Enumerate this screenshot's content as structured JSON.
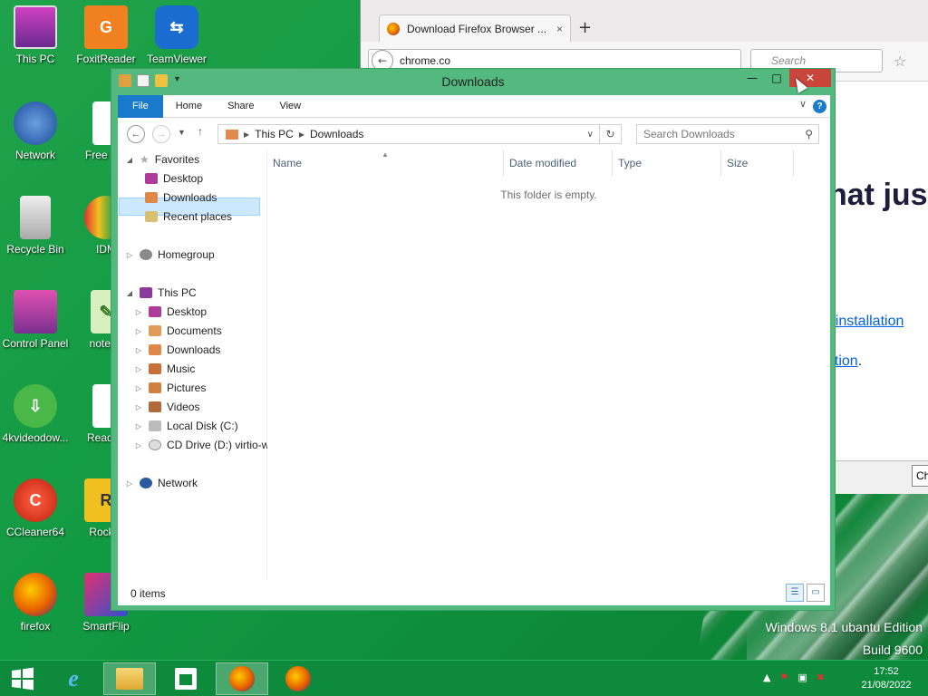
{
  "desktop": {
    "icons": [
      {
        "label": "This PC",
        "icon": "monitor-icon"
      },
      {
        "label": "FoxitReader",
        "icon": "foxit-icon"
      },
      {
        "label": "TeamViewer",
        "icon": "teamviewer-icon"
      },
      {
        "label": "Network",
        "icon": "globe-icon"
      },
      {
        "label": "Free Sof",
        "icon": "document-icon"
      },
      {
        "label": "Recycle Bin",
        "icon": "recycle-bin-icon"
      },
      {
        "label": "IDM",
        "icon": "idm-icon"
      },
      {
        "label": "Control Panel",
        "icon": "control-panel-icon"
      },
      {
        "label": "notepa",
        "icon": "notepad-icon"
      },
      {
        "label": "4kvideodow...",
        "icon": "download-icon"
      },
      {
        "label": "Read M",
        "icon": "document-icon"
      },
      {
        "label": "CCleaner64",
        "icon": "ccleaner-icon"
      },
      {
        "label": "Rocket",
        "icon": "rocket-icon"
      },
      {
        "label": "firefox",
        "icon": "firefox-icon"
      },
      {
        "label": "SmartFlip",
        "icon": "smartflip-icon"
      }
    ],
    "watermark_line1": "Windows 8.1 ubantu Edition",
    "watermark_line2": "Build 9600"
  },
  "browser": {
    "tab_title": "Download Firefox Browser ...",
    "tab_close": "×",
    "new_tab": "+",
    "url": "chrome.co",
    "search_placeholder": "Search",
    "heading_fragment": "hat jus",
    "link1_fragment": "r installation",
    "link2_fragment": "ation",
    "link2_period": ".",
    "bottom_button": "Ch"
  },
  "explorer": {
    "title": "Downloads",
    "window_buttons": {
      "min": "—",
      "max": "□",
      "close": "✕"
    },
    "ribbon_tabs": [
      "File",
      "Home",
      "Share",
      "View"
    ],
    "breadcrumb": [
      "This PC",
      "Downloads"
    ],
    "search_placeholder": "Search Downloads",
    "nav": {
      "favorites": "Favorites",
      "fav_items": [
        "Desktop",
        "Downloads",
        "Recent places"
      ],
      "homegroup": "Homegroup",
      "this_pc": "This PC",
      "pc_items": [
        "Desktop",
        "Documents",
        "Downloads",
        "Music",
        "Pictures",
        "Videos",
        "Local Disk (C:)",
        "CD Drive (D:) virtio-w"
      ],
      "network": "Network"
    },
    "columns": [
      "Name",
      "Date modified",
      "Type",
      "Size"
    ],
    "empty_message": "This folder is empty.",
    "status": "0 items"
  },
  "taskbar": {
    "clock_time": "17:52",
    "clock_date": "21/08/2022",
    "items": [
      "start-button",
      "internet-explorer",
      "file-explorer",
      "windows-store",
      "firefox",
      "firefox"
    ]
  }
}
